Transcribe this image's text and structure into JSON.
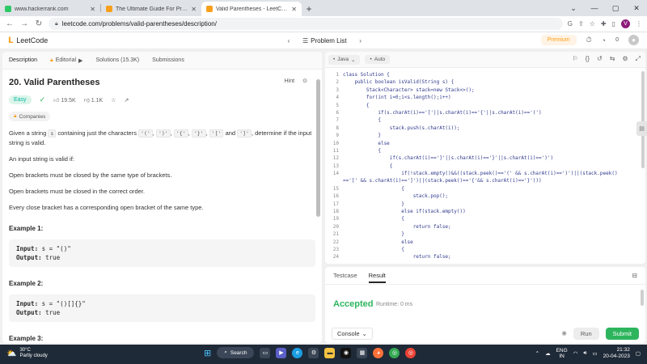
{
  "browser": {
    "tabs": [
      {
        "title": "www.hackerrank.com",
        "fav_color": "#2ec866",
        "active": false
      },
      {
        "title": "The Ultimate Guide For Preparin...",
        "fav_color": "#f89f1b",
        "active": false
      },
      {
        "title": "Valid Parentheses - LeetCode",
        "fav_color": "#f89f1b",
        "active": true
      }
    ],
    "url": "leetcode.com/problems/valid-parentheses/description/",
    "profile_initial": "V"
  },
  "header": {
    "logo_text": "LeetCode",
    "problem_list_label": "Problem List",
    "premium_label": "Premium",
    "notifications_count": "0"
  },
  "left": {
    "tabs": [
      "Description",
      "Editorial",
      "Solutions (15.3K)",
      "Submissions"
    ],
    "title": "20. Valid Parentheses",
    "hint_label": "Hint",
    "difficulty": "Easy",
    "likes": "19.5K",
    "dislikes": "1.1K",
    "companies_label": "Companies",
    "desc_p1_a": "Given a string",
    "desc_p1_s": "s",
    "desc_p1_b": "containing just the characters",
    "chars": [
      "'('",
      "')'",
      "'{'",
      "'}'",
      "'['",
      "']'"
    ],
    "desc_p1_and": "and",
    "desc_p1_c": ", determine if the input string is valid.",
    "desc_p2": "An input string is valid if:",
    "rules": [
      "Open brackets must be closed by the same type of brackets.",
      "Open brackets must be closed in the correct order.",
      "Every close bracket has a corresponding open bracket of the same type."
    ],
    "examples": [
      {
        "heading": "Example 1:",
        "input_label": "Input:",
        "input": "s = \"()\"",
        "output_label": "Output:",
        "output": "true"
      },
      {
        "heading": "Example 2:",
        "input_label": "Input:",
        "input": "s = \"()[]{}\"",
        "output_label": "Output:",
        "output": "true"
      }
    ],
    "example3_heading": "Example 3:"
  },
  "editor": {
    "language": "Java",
    "mode": "Auto",
    "lines": [
      {
        "n": "1",
        "text": "class Solution {"
      },
      {
        "n": "2",
        "text": "    public boolean isValid(String s) {"
      },
      {
        "n": "3",
        "text": "        Stack<Character> stack=new Stack<>();"
      },
      {
        "n": "4",
        "text": "        for(int i=0;i<s.length();i++)"
      },
      {
        "n": "5",
        "text": "        {"
      },
      {
        "n": "6",
        "text": "            if(s.charAt(i)=='['||s.charAt(i)=='{'||s.charAt(i)=='(')"
      },
      {
        "n": "7",
        "text": "            {"
      },
      {
        "n": "8",
        "text": "                stack.push(s.charAt(i));"
      },
      {
        "n": "9",
        "text": "            }"
      },
      {
        "n": "10",
        "text": "            else"
      },
      {
        "n": "11",
        "text": "            {"
      },
      {
        "n": "12",
        "text": "                if(s.charAt(i)==']'||s.charAt(i)=='}'||s.charAt(i)==')')"
      },
      {
        "n": "13",
        "text": "                {"
      },
      {
        "n": "14",
        "text": "                    if(!stack.empty()&&((stack.peek()=='(' && s.charAt(i)==')')||(stack.peek()"
      },
      {
        "n": "",
        "text": "=='[' && s.charAt(i)==']')||(stack.peek()=='{'&& s.charAt(i)=='}')))"
      },
      {
        "n": "15",
        "text": "                    {"
      },
      {
        "n": "16",
        "text": "                        stack.pop();"
      },
      {
        "n": "17",
        "text": "                    }"
      },
      {
        "n": "18",
        "text": "                    else if(stack.empty())"
      },
      {
        "n": "19",
        "text": "                    {"
      },
      {
        "n": "20",
        "text": "                        return false;"
      },
      {
        "n": "21",
        "text": "                    }"
      },
      {
        "n": "22",
        "text": "                    else"
      },
      {
        "n": "23",
        "text": "                    {"
      },
      {
        "n": "24",
        "text": "                        return false;"
      }
    ]
  },
  "bottom": {
    "tabs": [
      "Testcase",
      "Result"
    ],
    "status": "Accepted",
    "runtime": "Runtime: 0 ms",
    "console_label": "Console",
    "run_label": "Run",
    "submit_label": "Submit"
  },
  "taskbar": {
    "temp": "30°C",
    "weather": "Partly cloudy",
    "search_label": "Search",
    "lang_top": "ENG",
    "lang_bottom": "IN",
    "time": "21:32",
    "date": "20-04-2023"
  }
}
